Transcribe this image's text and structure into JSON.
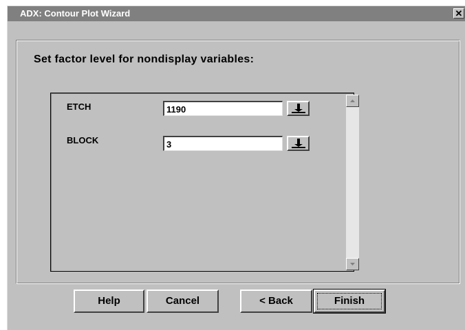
{
  "window": {
    "title": "ADX: Contour Plot Wizard",
    "close_glyph": "✕"
  },
  "heading": "Set factor level for nondisplay variables:",
  "variables": [
    {
      "label": "ETCH",
      "value": "1190",
      "dropdown_icon": "push-down-icon"
    },
    {
      "label": "BLOCK",
      "value": "3",
      "dropdown_icon": "push-down-icon"
    }
  ],
  "buttons": {
    "help": "Help",
    "cancel": "Cancel",
    "back": "< Back",
    "finish": "Finish"
  },
  "colors": {
    "face": "#c0c0c0",
    "titlebar": "#808080"
  }
}
